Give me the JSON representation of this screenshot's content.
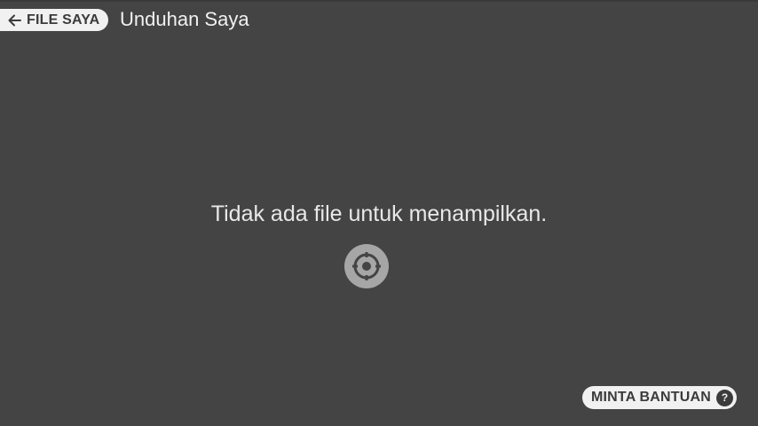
{
  "header": {
    "back_label": "FILE SAYA",
    "title": "Unduhan Saya"
  },
  "main": {
    "empty_message": "Tidak ada file untuk menampilkan.",
    "target_icon": "crosshair-target-icon"
  },
  "footer": {
    "help_label": "MINTA BANTUAN",
    "help_icon_glyph": "?"
  },
  "colors": {
    "background": "#444444",
    "pill": "#f1f1f1",
    "pill_text": "#3b3b3b",
    "target_circle": "#a6a6a6"
  }
}
